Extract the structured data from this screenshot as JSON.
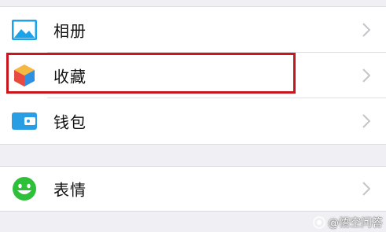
{
  "menu": {
    "group1": [
      {
        "label": "相册",
        "icon": "photo-album-icon"
      },
      {
        "label": "收藏",
        "icon": "favorites-cube-icon"
      },
      {
        "label": "钱包",
        "icon": "wallet-icon"
      }
    ],
    "group2": [
      {
        "label": "表情",
        "icon": "smiley-face-icon"
      }
    ]
  },
  "watermark": {
    "text": "@悟空问答"
  },
  "colors": {
    "background": "#efeff4",
    "highlight": "#c8161d",
    "album_blue": "#1aa3e8",
    "wallet_blue": "#2a9ee5",
    "sticker_green": "#2fc03a"
  }
}
